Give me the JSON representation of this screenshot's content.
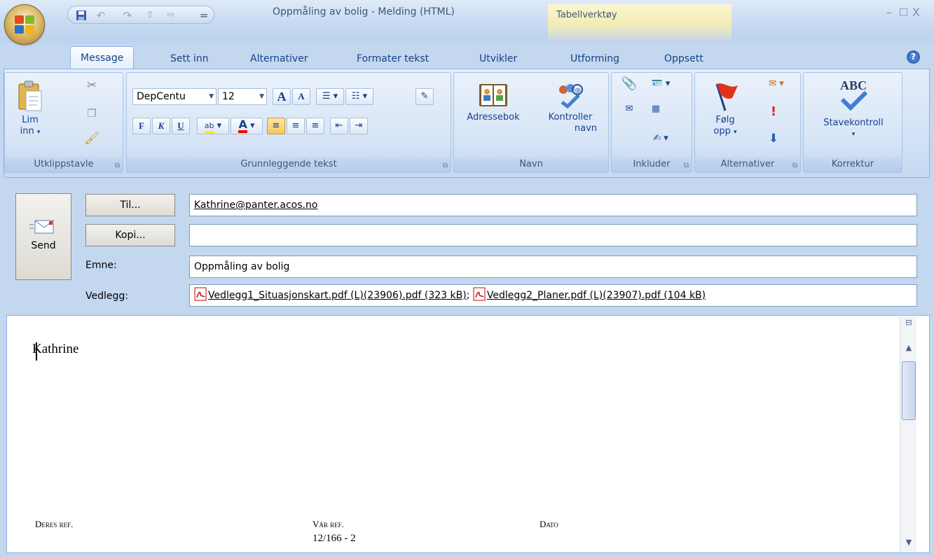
{
  "window": {
    "title": "Oppmåling av bolig - Melding (HTML)",
    "context_tab_group": "Tabellverktøy",
    "minimize": "–",
    "maximize": "□",
    "close": "X"
  },
  "qat": {
    "customize": "="
  },
  "tabs": [
    {
      "label": "Message",
      "active": true
    },
    {
      "label": "Sett inn"
    },
    {
      "label": "Alternativer"
    },
    {
      "label": "Formater tekst"
    },
    {
      "label": "Utvikler"
    },
    {
      "label": "Utforming"
    },
    {
      "label": "Oppsett"
    }
  ],
  "help_glyph": "?",
  "ribbon": {
    "clipboard": {
      "label": "Utklippstavle",
      "paste_label": "Lim",
      "paste_label2": "inn"
    },
    "basic_text": {
      "label": "Grunnleggende tekst",
      "font": "DepCentu",
      "size": "12",
      "grow": "A",
      "shrink": "A",
      "bold": "F",
      "italic": "K",
      "underline": "U",
      "font_color": "A"
    },
    "names": {
      "label": "Navn",
      "address_book": "Adressebok",
      "check_names": "Kontroller",
      "check_names2": "navn"
    },
    "include": {
      "label": "Inkluder"
    },
    "options": {
      "label": "Alternativer",
      "follow_up": "Følg",
      "follow_up2": "opp"
    },
    "proofing": {
      "label": "Korrektur",
      "spelling": "Stavekontroll",
      "abc": "ABC"
    }
  },
  "header": {
    "send_label": "Send",
    "to_button": "Til...",
    "cc_button": "Kopi...",
    "subject_label": "Emne:",
    "attachments_label": "Vedlegg:",
    "to_value": "Kathrine@panter.acos.no",
    "cc_value": "",
    "subject_value": "Oppmåling av bolig",
    "attachments": [
      "Vedlegg1_Situasjonskart.pdf (L)(23906).pdf (323 kB)",
      "Vedlegg2_Planer.pdf (L)(23907).pdf (104 kB)"
    ],
    "attachment_separator": ";"
  },
  "body": {
    "greeting": "Kathrine",
    "deres_ref_label": "Deres ref.",
    "var_ref_label": "Vår ref.",
    "var_ref_value": "12/166 - 2",
    "dato_label": "Dato"
  },
  "colors": {
    "ribbon_bg": "#d3e2f6",
    "text_blue": "#15428b",
    "context_band": "#f4ecb6"
  }
}
